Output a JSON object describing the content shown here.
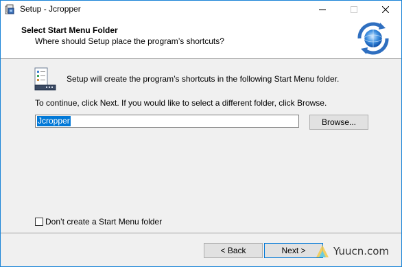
{
  "window": {
    "title": "Setup - Jcropper",
    "controls": {
      "minimize_icon": "minimize-icon",
      "maximize_icon": "maximize-icon",
      "close_icon": "close-icon"
    }
  },
  "header": {
    "title": "Select Start Menu Folder",
    "subtitle": "Where should Setup place the program’s shortcuts?",
    "logo_icon": "setup-wizard-logo-icon"
  },
  "content": {
    "icon": "start-menu-folder-icon",
    "intro": "Setup will create the program’s shortcuts in the following Start Menu folder.",
    "instructions": "To continue, click Next. If you would like to select a different folder, click Browse.",
    "folder_value": "Jcropper",
    "browse_label": "Browse...",
    "no_folder_checkbox": {
      "label": "Don’t create a Start Menu folder",
      "checked": false
    }
  },
  "footer": {
    "back_label": "< Back",
    "next_label": "Next >",
    "watermark_text": "Yuucn.com"
  },
  "colors": {
    "accent": "#0078d7",
    "title_border": "#1883d7",
    "dialog_bg": "#f0f0f0"
  }
}
